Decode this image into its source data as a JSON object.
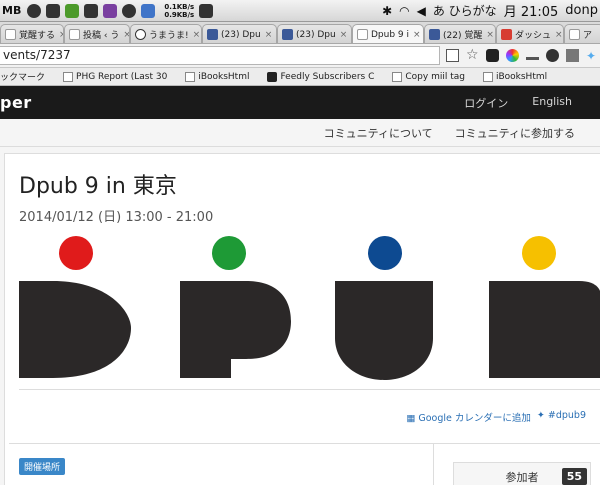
{
  "menubar": {
    "left_text": "MB",
    "net_up": "0.1KB/s",
    "net_down": "0.9KB/s",
    "ime": "あ ひらがな",
    "time": "月 21:05",
    "user": "donp"
  },
  "tabs": [
    {
      "label": "覚醒する",
      "icon": "page-icon"
    },
    {
      "label": "投稿 ‹ う",
      "icon": "page-icon"
    },
    {
      "label": "うまうま!",
      "icon": "face-icon"
    },
    {
      "label": "(23) Dpu",
      "icon": "facebook-icon"
    },
    {
      "label": "(23) Dpu",
      "icon": "facebook-icon"
    },
    {
      "label": "Dpub 9 i",
      "icon": "page-icon"
    },
    {
      "label": "(22) 覚醒",
      "icon": "facebook-icon"
    },
    {
      "label": "ダッシュ",
      "icon": "googleplus-icon"
    },
    {
      "label": "ア",
      "icon": "page-icon"
    }
  ],
  "address": {
    "url": "vents/7237"
  },
  "bookmarks": [
    {
      "label": "ックマーク",
      "icon": "none"
    },
    {
      "label": "PHG Report (Last 30",
      "icon": "page-icon"
    },
    {
      "label": "iBooksHtml",
      "icon": "page-icon"
    },
    {
      "label": "Feedly Subscribers C",
      "icon": "feedly-icon"
    },
    {
      "label": "Copy miil tag",
      "icon": "page-icon"
    },
    {
      "label": "iBooksHtml",
      "icon": "page-icon"
    }
  ],
  "site": {
    "logo": "per",
    "login": "ログイン",
    "language": "English",
    "subnav": [
      "コミュニティについて",
      "コミュニティに参加する"
    ]
  },
  "event": {
    "title": "Dpub 9 in 東京",
    "date": "2014/01/12 (日) 13:00 - 21:00",
    "calendar_link": "Google カレンダーに追加",
    "hashtag": "#dpub9",
    "venue_badge": "開催場所",
    "participants_label": "参加者",
    "participants_count": "55"
  },
  "colors": {
    "header_bg": "#1a1a1a",
    "dot_red": "#e01b1b",
    "dot_green": "#1e9a36",
    "dot_blue": "#0d4a91",
    "dot_yellow": "#f6c000",
    "letter_fill": "#2b2828",
    "link": "#2a6fb4",
    "badge_blue": "#3a87c8"
  }
}
